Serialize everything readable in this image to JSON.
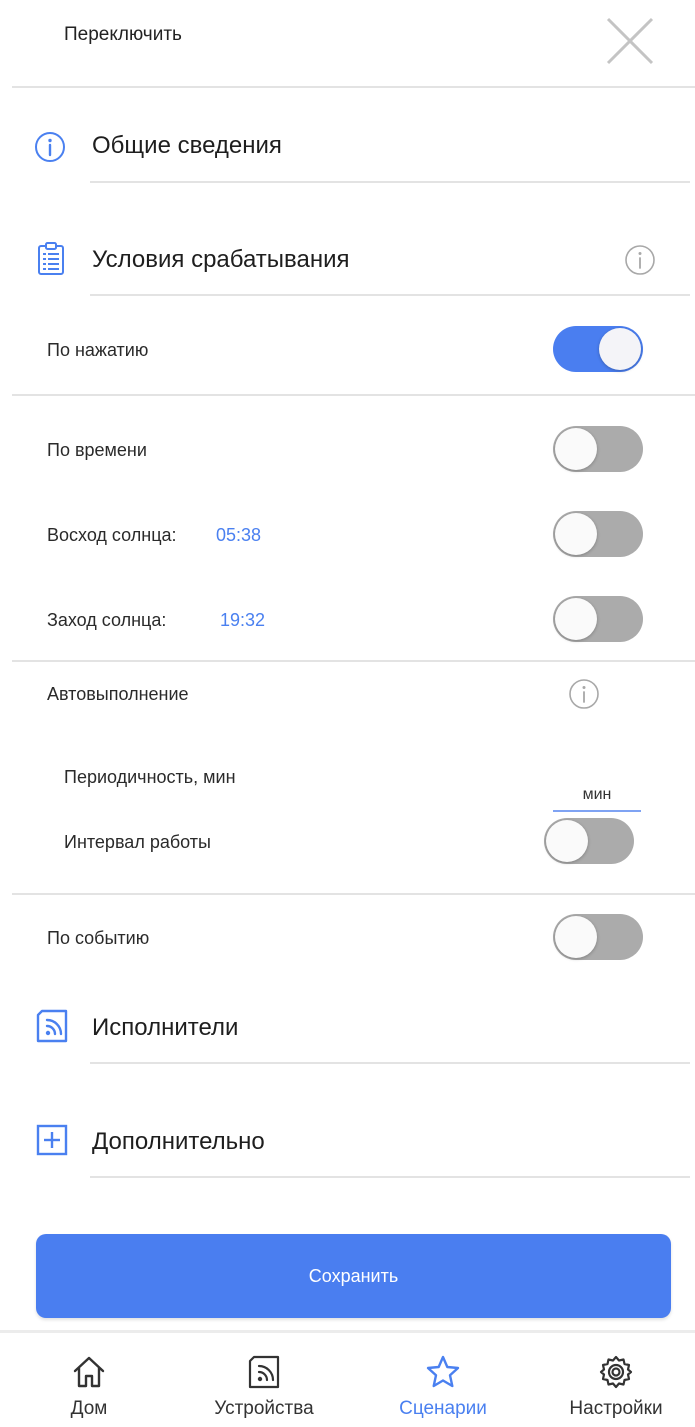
{
  "header": {
    "title": "Переключить",
    "close_icon": "close-icon"
  },
  "sections": {
    "general": {
      "label": "Общие сведения",
      "icon": "info-circle-icon"
    },
    "triggers": {
      "label": "Условия срабатывания",
      "icon": "clipboard-list-icon",
      "help_icon": "info-circle-icon"
    },
    "executors": {
      "label": "Исполнители",
      "icon": "device-wifi-icon"
    },
    "additional": {
      "label": "Дополнительно",
      "icon": "plus-square-icon"
    }
  },
  "triggers": {
    "on_press": {
      "label": "По нажатию",
      "enabled": true
    },
    "by_time": {
      "label": "По времени",
      "enabled": false
    },
    "sunrise": {
      "label": "Восход солнца:",
      "time": "05:38",
      "enabled": false
    },
    "sunset": {
      "label": "Заход солнца:",
      "time": "19:32",
      "enabled": false
    },
    "auto": {
      "label": "Автовыполнение",
      "period_label": "Периодичность, мин",
      "period_value": "",
      "period_placeholder": "мин",
      "interval_label": "Интервал работы",
      "interval_enabled": false
    },
    "by_event": {
      "label": "По событию",
      "enabled": false
    }
  },
  "save_button": {
    "label": "Сохранить"
  },
  "tabbar": {
    "items": [
      {
        "label": "Дом",
        "icon": "home-icon",
        "active": false
      },
      {
        "label": "Устройства",
        "icon": "device-wifi-icon",
        "active": false
      },
      {
        "label": "Сценарии",
        "icon": "star-icon",
        "active": true
      },
      {
        "label": "Настройки",
        "icon": "gear-icon",
        "active": false
      }
    ]
  },
  "colors": {
    "accent": "#4a7ef0",
    "toggle_off": "#ababab",
    "divider": "#e3e3e3",
    "time_text": "#4a80f0"
  }
}
